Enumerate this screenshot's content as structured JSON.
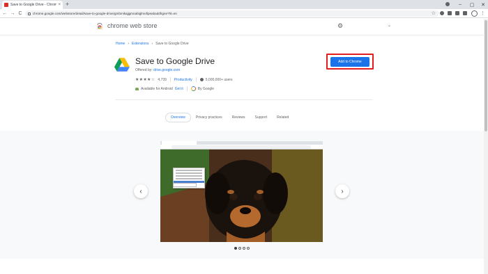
{
  "browser": {
    "tab_title": "Save to Google Drive - Chrome",
    "tab_close": "×",
    "new_tab": "+",
    "minimize": "–",
    "maximize": "▢",
    "close": "✕",
    "back": "←",
    "forward": "→",
    "reload": "C",
    "url": "chrome.google.com/webstore/detail/save-to-google-drive/gmbmikajjgmnabiglmofipeabaddhgne?hl=en",
    "star": "☆",
    "menu": "⋮"
  },
  "store": {
    "name": "chrome web store",
    "settings_icon": "gear-icon",
    "caret": "⌄"
  },
  "breadcrumb": {
    "home": "Home",
    "extensions": "Extensions",
    "current": "Save to Google Drive",
    "separator": "›"
  },
  "extension": {
    "title": "Save to Google Drive",
    "offered_by_label": "Offered by:",
    "offered_by": "drive.google.com",
    "rating_stars": "★★★★☆",
    "rating_count": "4,739",
    "category": "Productivity",
    "users": "5,000,000+ users",
    "android_text": "Available for Android",
    "android_link": "Get it",
    "by_google": "By Google",
    "add_button": "Add to Chrome"
  },
  "tabs": [
    "Overview",
    "Privacy practices",
    "Reviews",
    "Support",
    "Related"
  ],
  "gallery": {
    "prev": "‹",
    "next": "›",
    "slide_count": 4,
    "active_slide": 1
  }
}
